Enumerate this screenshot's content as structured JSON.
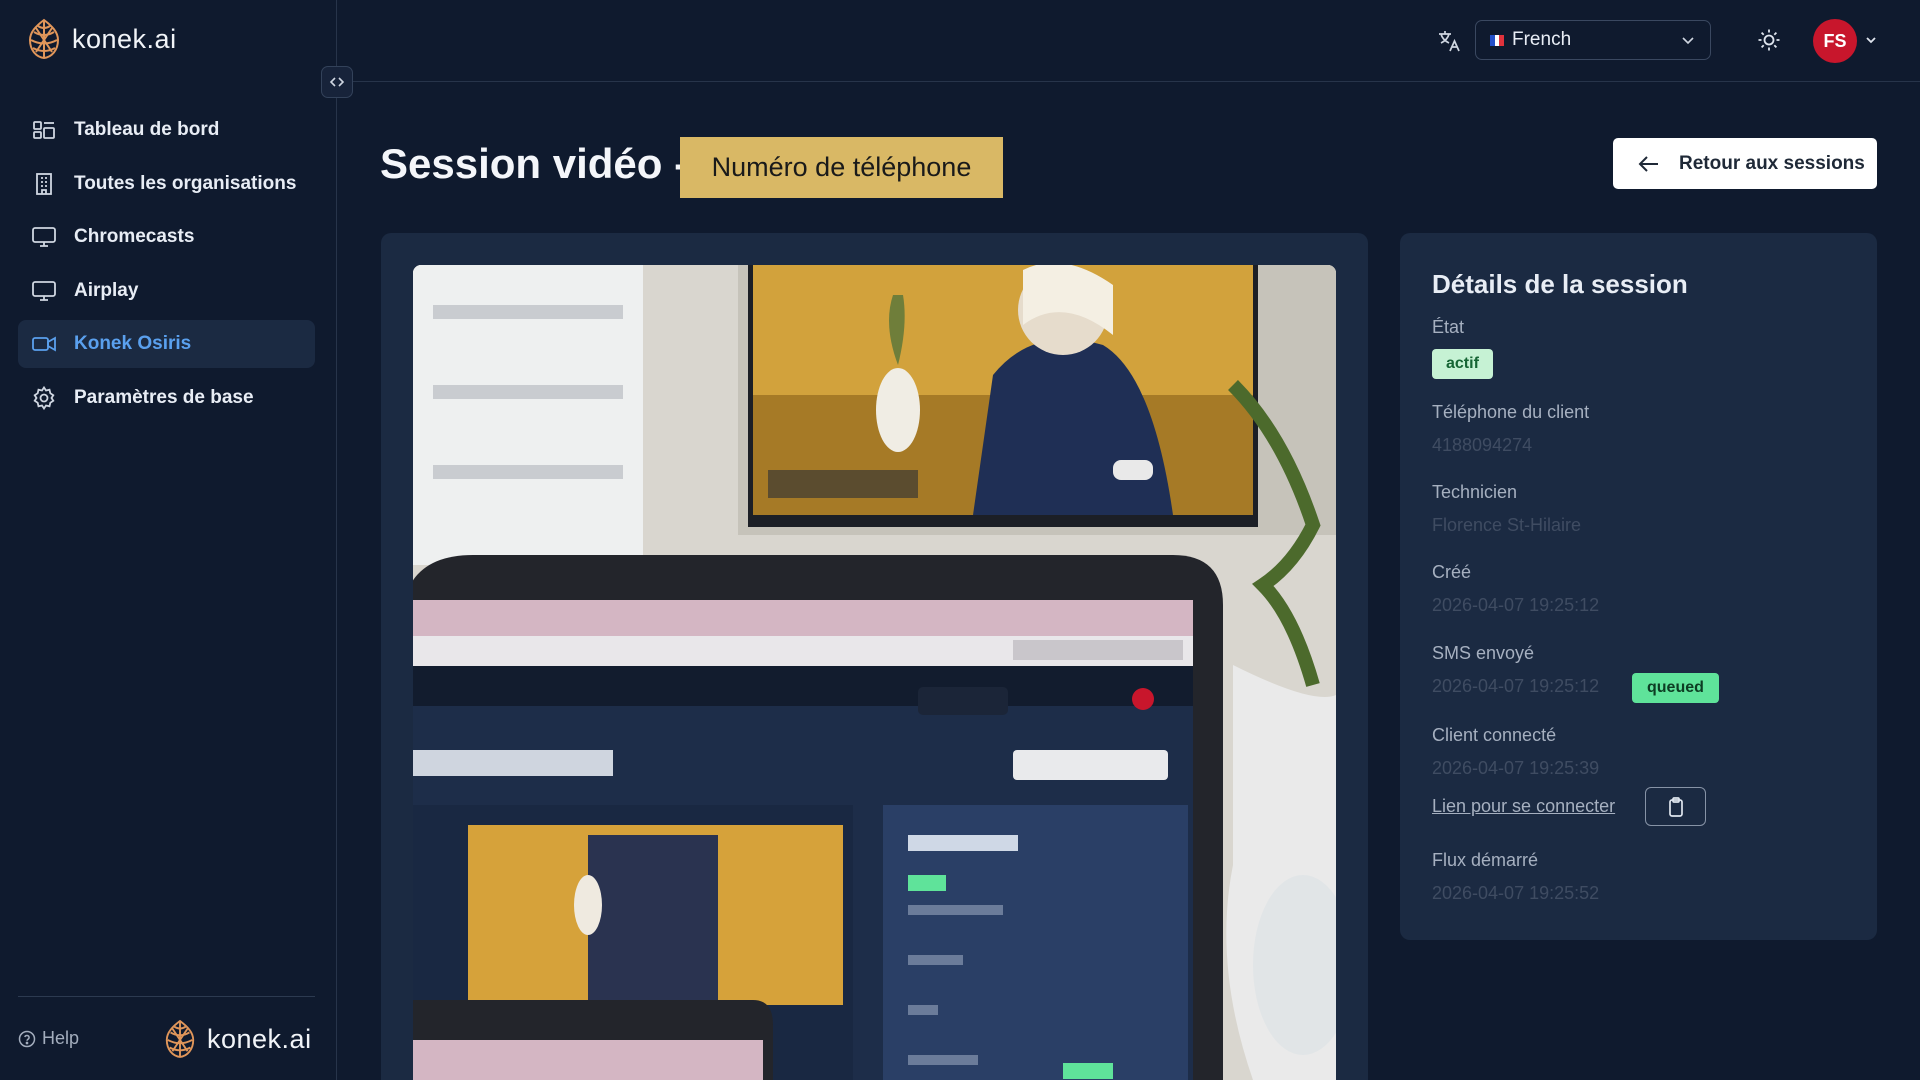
{
  "brand": {
    "name": "konek.ai"
  },
  "sidebar": {
    "items": [
      {
        "label": "Tableau de bord",
        "icon": "dashboard-icon",
        "active": false
      },
      {
        "label": "Toutes les organisations",
        "icon": "building-icon",
        "active": false
      },
      {
        "label": "Chromecasts",
        "icon": "monitor-icon",
        "active": false
      },
      {
        "label": "Airplay",
        "icon": "monitor-icon",
        "active": false
      },
      {
        "label": "Konek Osiris",
        "icon": "video-camera-icon",
        "active": true
      },
      {
        "label": "Paramètres de base",
        "icon": "gear-icon",
        "active": false
      }
    ],
    "help_label": "Help"
  },
  "header": {
    "language": "French",
    "avatar_initials": "FS"
  },
  "main": {
    "title": "Session vidéo -",
    "title_badge": "Numéro de téléphone",
    "back_button": "Retour aux sessions"
  },
  "details": {
    "title": "Détails de la session",
    "state_label": "État",
    "state_value": "actif",
    "phone_label": "Téléphone du client",
    "phone_value": "4188094274",
    "technician_label": "Technicien",
    "technician_value": "Florence St-Hilaire",
    "created_label": "Créé",
    "created_value": "2026-04-07 19:25:12",
    "sms_label": "SMS envoyé",
    "sms_value": "2026-04-07 19:25:12",
    "sms_status": "queued",
    "client_label": "Client connecté",
    "client_value": "2026-04-07 19:25:39",
    "connect_link": "Lien pour se connecter",
    "stream_label": "Flux démarré",
    "stream_value": "2026-04-07 19:25:52"
  },
  "colors": {
    "background": "#0f1a2e",
    "card": "#1b2a42",
    "active_nav_text": "#5aa0ee",
    "title_badge_bg": "#d9b865",
    "avatar_bg": "#c8162c",
    "status_active_bg": "#c6f2d4",
    "status_queued_bg": "#5fe39a"
  }
}
